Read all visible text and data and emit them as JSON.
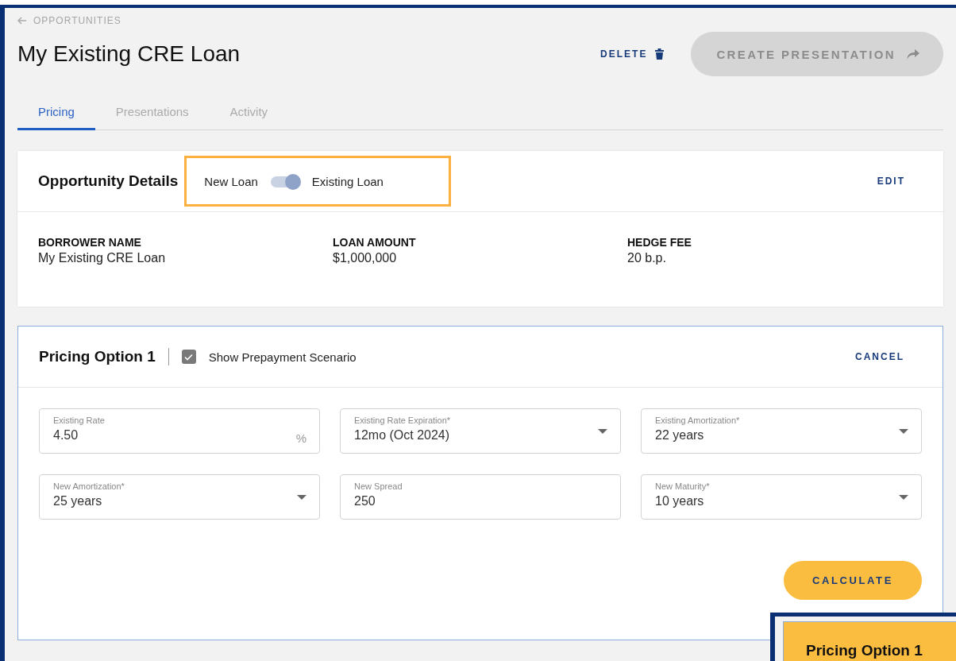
{
  "breadcrumb": {
    "label": "OPPORTUNITIES"
  },
  "title": "My Existing CRE Loan",
  "actions": {
    "delete": "DELETE",
    "create": {
      "label": "CREATE PRESENTATION",
      "disabled": true
    }
  },
  "tabs": [
    {
      "label": "Pricing",
      "selected": true
    },
    {
      "label": "Presentations",
      "selected": false
    },
    {
      "label": "Activity",
      "selected": false
    }
  ],
  "details": {
    "title": "Opportunity Details",
    "toggle": {
      "off_label": "New Loan",
      "on_label": "Existing Loan",
      "on": true
    },
    "edit": "EDIT",
    "fields": [
      {
        "label": "BORROWER NAME",
        "value": "My Existing CRE Loan"
      },
      {
        "label": "LOAN AMOUNT",
        "value": "$1,000,000"
      },
      {
        "label": "HEDGE FEE",
        "value": "20 b.p."
      }
    ]
  },
  "pricing": {
    "title": "Pricing Option 1",
    "prepayment": {
      "label": "Show Prepayment Scenario",
      "checked": true
    },
    "cancel": "CANCEL",
    "inputs": [
      {
        "kind": "text",
        "label": "Existing Rate",
        "value": "4.50",
        "unit": "%"
      },
      {
        "kind": "select",
        "label": "Existing Rate Expiration*",
        "value": "12mo (Oct 2024)"
      },
      {
        "kind": "select",
        "label": "Existing Amortization*",
        "value": "22 years"
      },
      {
        "kind": "select",
        "label": "New Amortization*",
        "value": "25 years"
      },
      {
        "kind": "text",
        "label": "New Spread",
        "value": "250"
      },
      {
        "kind": "select",
        "label": "New Maturity*",
        "value": "10 years"
      }
    ],
    "calculate": "CALCULATE"
  },
  "inset": {
    "title": "Pricing Option 1"
  }
}
